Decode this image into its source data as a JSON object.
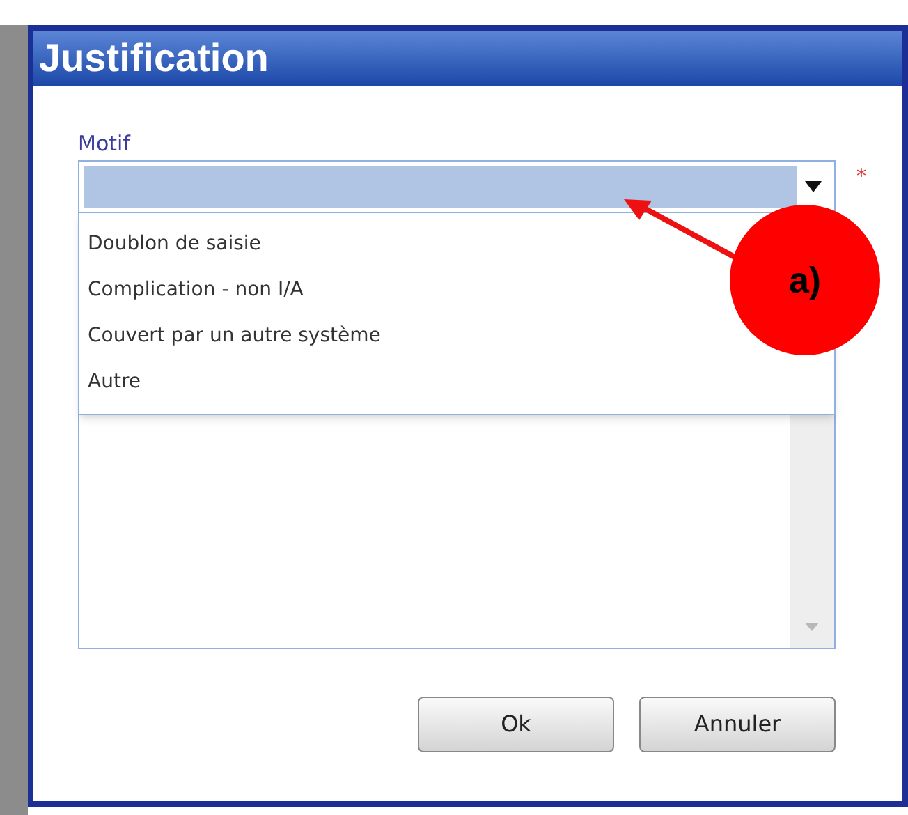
{
  "dialog": {
    "title": "Justification"
  },
  "motif": {
    "label": "Motif",
    "required_mark": "*",
    "expanded": true
  },
  "dropdown_options": [
    {
      "label": "Doublon de saisie",
      "selected": false
    },
    {
      "label": "Complication - non I/A",
      "selected": false
    },
    {
      "label": "Couvert par un autre système",
      "selected": false
    },
    {
      "label": "Autre",
      "selected": false
    }
  ],
  "buttons": [
    "Ok",
    "Annuler"
  ],
  "annotation": {
    "label": "a)"
  }
}
